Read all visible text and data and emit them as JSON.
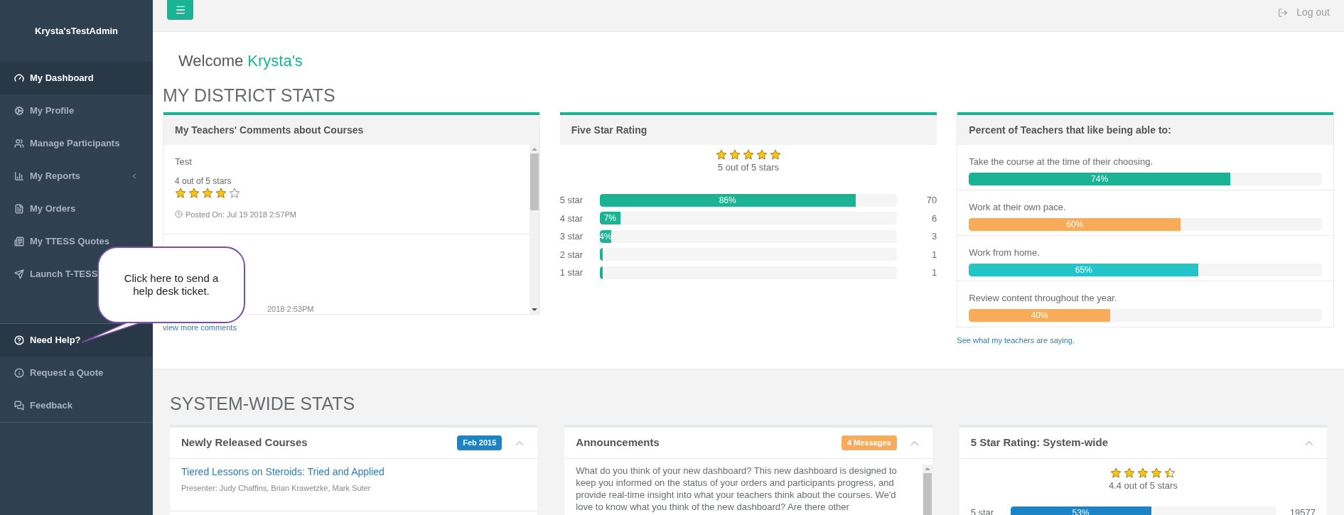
{
  "sidebar": {
    "title": "Krysta'sTestAdmin",
    "items": [
      {
        "label": "My Dashboard",
        "selected": true
      },
      {
        "label": "My Profile",
        "selected": false
      },
      {
        "label": "Manage Participants",
        "selected": false
      },
      {
        "label": "My Reports",
        "selected": false,
        "expandable": true
      },
      {
        "label": "My Orders",
        "selected": false
      },
      {
        "label": "My TTESS Quotes",
        "selected": false
      },
      {
        "label": "Launch T-TESS",
        "selected": false
      }
    ],
    "help_items": [
      {
        "label": "Need Help?",
        "selected": true
      },
      {
        "label": "Request a Quote",
        "selected": false
      },
      {
        "label": "Feedback",
        "selected": false
      }
    ]
  },
  "topbar": {
    "logout": "Log out"
  },
  "callout": {
    "text": "Click here to send a help desk ticket."
  },
  "welcome": {
    "text": "Welcome",
    "name": "Krysta's"
  },
  "district": {
    "heading": "MY DISTRICT STATS",
    "comments": {
      "title": "My Teachers' Comments about Courses",
      "items": [
        {
          "title": "Test",
          "rating_text": "4 out of 5 stars",
          "stars": 4,
          "posted": "Posted On: Jul 19 2018 2:57PM"
        },
        {
          "posted": "2018 2:53PM"
        }
      ],
      "link": "view more comments"
    },
    "rating": {
      "title": "Five Star Rating",
      "stars": 5,
      "rating_text": "5 out of 5 stars",
      "rows": [
        {
          "label": "5 star",
          "level": 0.86,
          "percent": "86%",
          "count": "70"
        },
        {
          "label": "4 star",
          "level": 0.07,
          "percent": "7%",
          "count": "6"
        },
        {
          "label": "3 star",
          "level": 0.04,
          "percent": "4%",
          "count": "3"
        },
        {
          "label": "2 star",
          "level": 0.01,
          "count": "1"
        },
        {
          "label": "1 star",
          "level": 0.01,
          "count": "1"
        }
      ]
    },
    "percent": {
      "title": "Percent of Teachers that like being able to:",
      "items": [
        {
          "text": "Take the course at the time of their choosing.",
          "level": 0.74,
          "percent": "74%",
          "color": "#1ab394"
        },
        {
          "text": "Work at their own pace.",
          "level": 0.6,
          "percent": "60%",
          "color": "#f8ac59"
        },
        {
          "text": "Work from home.",
          "level": 0.65,
          "percent": "65%",
          "color": "#23c6c8"
        },
        {
          "text": "Review content throughout the year.",
          "level": 0.4,
          "percent": "40%",
          "color": "#f8ac59"
        }
      ],
      "link": "See what my teachers are saying."
    }
  },
  "system": {
    "heading": "SYSTEM-WIDE STATS",
    "courses": {
      "title": "Newly Released Courses",
      "badge": {
        "text": "Feb 2015",
        "color": "#1c84c6"
      },
      "items": [
        {
          "title": "Tiered Lessons on Steroids: Tried and Applied",
          "presenter": "Presenter: Judy Chaffins, Brian Krawetzke, Mark Suter"
        }
      ]
    },
    "announcements": {
      "title": "Announcements",
      "badge": {
        "text": "4 Messages",
        "color": "#f8ac59"
      },
      "text": "What do you think of your new dashboard? This new dashboard is designed to keep you informed on the status of your orders and participants progress, and provide real-time insight into what your teachers think about the courses. We'd love to know what you think of the new dashboard? Are there other"
    },
    "rating": {
      "title": "5 Star Rating: System-wide",
      "stars": 4.4,
      "rating_text": "4.4 out of 5 stars",
      "rows": [
        {
          "label": "5 star",
          "level": 0.53,
          "percent": "53%",
          "count": "19577"
        }
      ]
    }
  }
}
